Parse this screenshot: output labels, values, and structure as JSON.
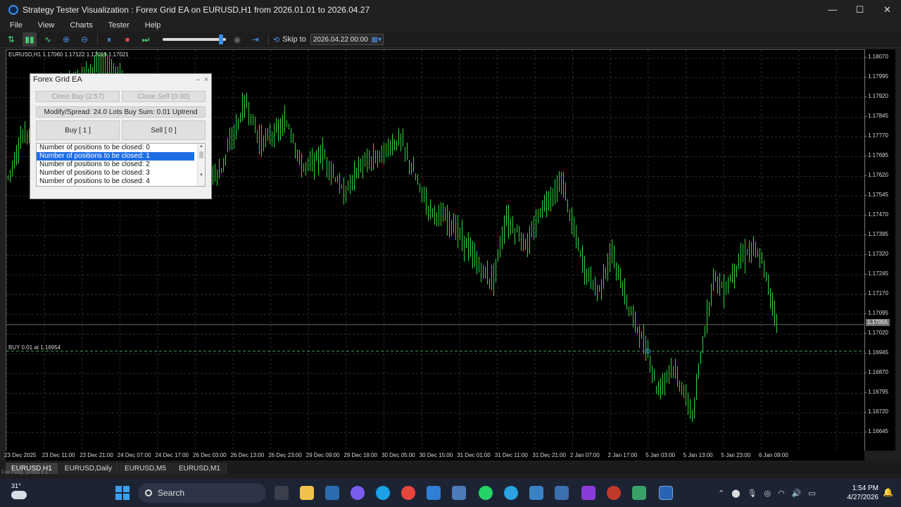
{
  "window": {
    "title": "Strategy Tester Visualization : Forex Grid EA on EURUSD,H1 from 2026.01.01 to 2026.04.27",
    "minimize": "—",
    "maximize": "☐",
    "close": "✕"
  },
  "menu": [
    "File",
    "View",
    "Charts",
    "Tester",
    "Help"
  ],
  "toolbar": {
    "speed_value": 0.95,
    "skip_label": "Skip to",
    "skip_value": "2026.04.22 00:00"
  },
  "chart": {
    "info": "EURUSD,H1  1.17060 1.17122 1.17019 1.17021",
    "order_label": "BUY 0.01 at 1.16954",
    "current_price": "1.17055",
    "price_ticks": [
      "1.18070",
      "1.17995",
      "1.17920",
      "1.17845",
      "1.17770",
      "1.17695",
      "1.17620",
      "1.17545",
      "1.17470",
      "1.17395",
      "1.17320",
      "1.17245",
      "1.17170",
      "1.17095",
      "1.17020",
      "1.16945",
      "1.16870",
      "1.16795",
      "1.16720",
      "1.16645"
    ],
    "time_ticks": [
      "23 Dec 2025",
      "23 Dec 11:00",
      "23 Dec 21:00",
      "24 Dec 07:00",
      "24 Dec 17:00",
      "26 Dec 03:00",
      "26 Dec 13:00",
      "26 Dec 23:00",
      "29 Dec 09:00",
      "29 Dec 19:00",
      "30 Dec 05:00",
      "30 Dec 15:00",
      "31 Dec 01:00",
      "31 Dec 11:00",
      "31 Dec 21:00",
      "2 Jan 07:00",
      "2 Jan 17:00",
      "5 Jan 03:00",
      "5 Jan 13:00",
      "5 Jan 23:00",
      "6 Jan 09:00"
    ]
  },
  "chart_tabs": [
    "EURUSD,H1",
    "EURUSD,Daily",
    "EURUSD,M5",
    "EURUSD,M1"
  ],
  "status_text": "For Help, press F1",
  "ea_panel": {
    "title": "Forex Grid EA",
    "minimize": "–",
    "close": "×",
    "close_buy": "Close Buy (2.57)",
    "close_sell": "Close Sell (0.00)",
    "info": "Modify/Spread: 24.0 Lots Buy Sum: 0.01 Uptrend",
    "buy": "Buy [ 1 ]",
    "sell": "Sell [ 0 ]",
    "list": [
      "Number of positions to be closed:  0",
      "Number of positions to be closed:  1",
      "Number of positions to be closed:  2",
      "Number of positions to be closed:  3",
      "Number of positions to be closed:  4"
    ],
    "selected_index": 1
  },
  "taskbar": {
    "weather": "31°",
    "search": "Search",
    "time": "1:54 PM",
    "date": "4/27/2026"
  },
  "colors": {
    "candle": "#2fd63d",
    "grid": "#2a2a2a",
    "accent": "#1e6ee6",
    "order_line": "#3aa05a"
  }
}
